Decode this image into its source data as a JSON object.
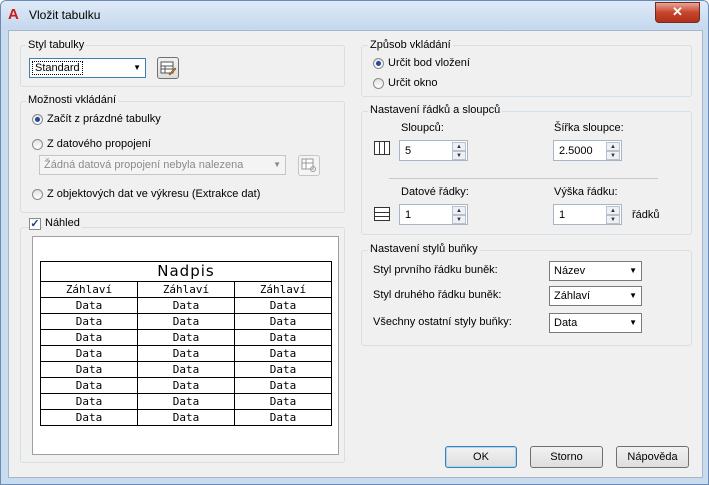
{
  "window": {
    "title": "Vložit tabulku",
    "close_glyph": "✕"
  },
  "table_style": {
    "group_label": "Styl tabulky",
    "selected": "Standard",
    "options": [
      "Standard"
    ]
  },
  "insert_options": {
    "group_label": "Možnosti vkládání",
    "radio_empty": "Začít z prázdné tabulky",
    "radio_data_link": "Z datového propojení",
    "data_link_combo": "Žádná datová propojení nebyla nalezena",
    "radio_extract": "Z objektových dat ve výkresu (Extrakce dat)"
  },
  "preview": {
    "checkbox_label": "Náhled",
    "checked": true,
    "title": "Nadpis",
    "headers": [
      "Záhlaví",
      "Záhlaví",
      "Záhlaví"
    ],
    "rows": [
      [
        "Data",
        "Data",
        "Data"
      ],
      [
        "Data",
        "Data",
        "Data"
      ],
      [
        "Data",
        "Data",
        "Data"
      ],
      [
        "Data",
        "Data",
        "Data"
      ],
      [
        "Data",
        "Data",
        "Data"
      ],
      [
        "Data",
        "Data",
        "Data"
      ],
      [
        "Data",
        "Data",
        "Data"
      ],
      [
        "Data",
        "Data",
        "Data"
      ]
    ]
  },
  "insertion": {
    "group_label": "Způsob vkládání",
    "radio_point": "Určit bod vložení",
    "radio_window": "Určit okno",
    "selected": "point"
  },
  "rows_columns": {
    "group_label": "Nastavení řádků a sloupců",
    "columns_label": "Sloupců:",
    "columns_value": "5",
    "col_width_label": "Šířka sloupce:",
    "col_width_value": "2.5000",
    "data_rows_label": "Datové řádky:",
    "data_rows_value": "1",
    "row_height_label": "Výška řádku:",
    "row_height_value": "1",
    "row_height_unit": "řádků"
  },
  "cell_styles": {
    "group_label": "Nastavení stylů buňky",
    "first_row_label": "Styl prvního řádku buněk:",
    "first_row_value": "Název",
    "second_row_label": "Styl druhého řádku buněk:",
    "second_row_value": "Záhlaví",
    "other_rows_label": "Všechny ostatní styly buňky:",
    "other_rows_value": "Data"
  },
  "buttons": {
    "ok": "OK",
    "cancel": "Storno",
    "help": "Nápověda"
  },
  "colors": {
    "title_gradient_top": "#dfeaf7",
    "client_bg": "#f0f0f0",
    "close_red": "#c7452c",
    "radio_dot": "#23489c"
  }
}
